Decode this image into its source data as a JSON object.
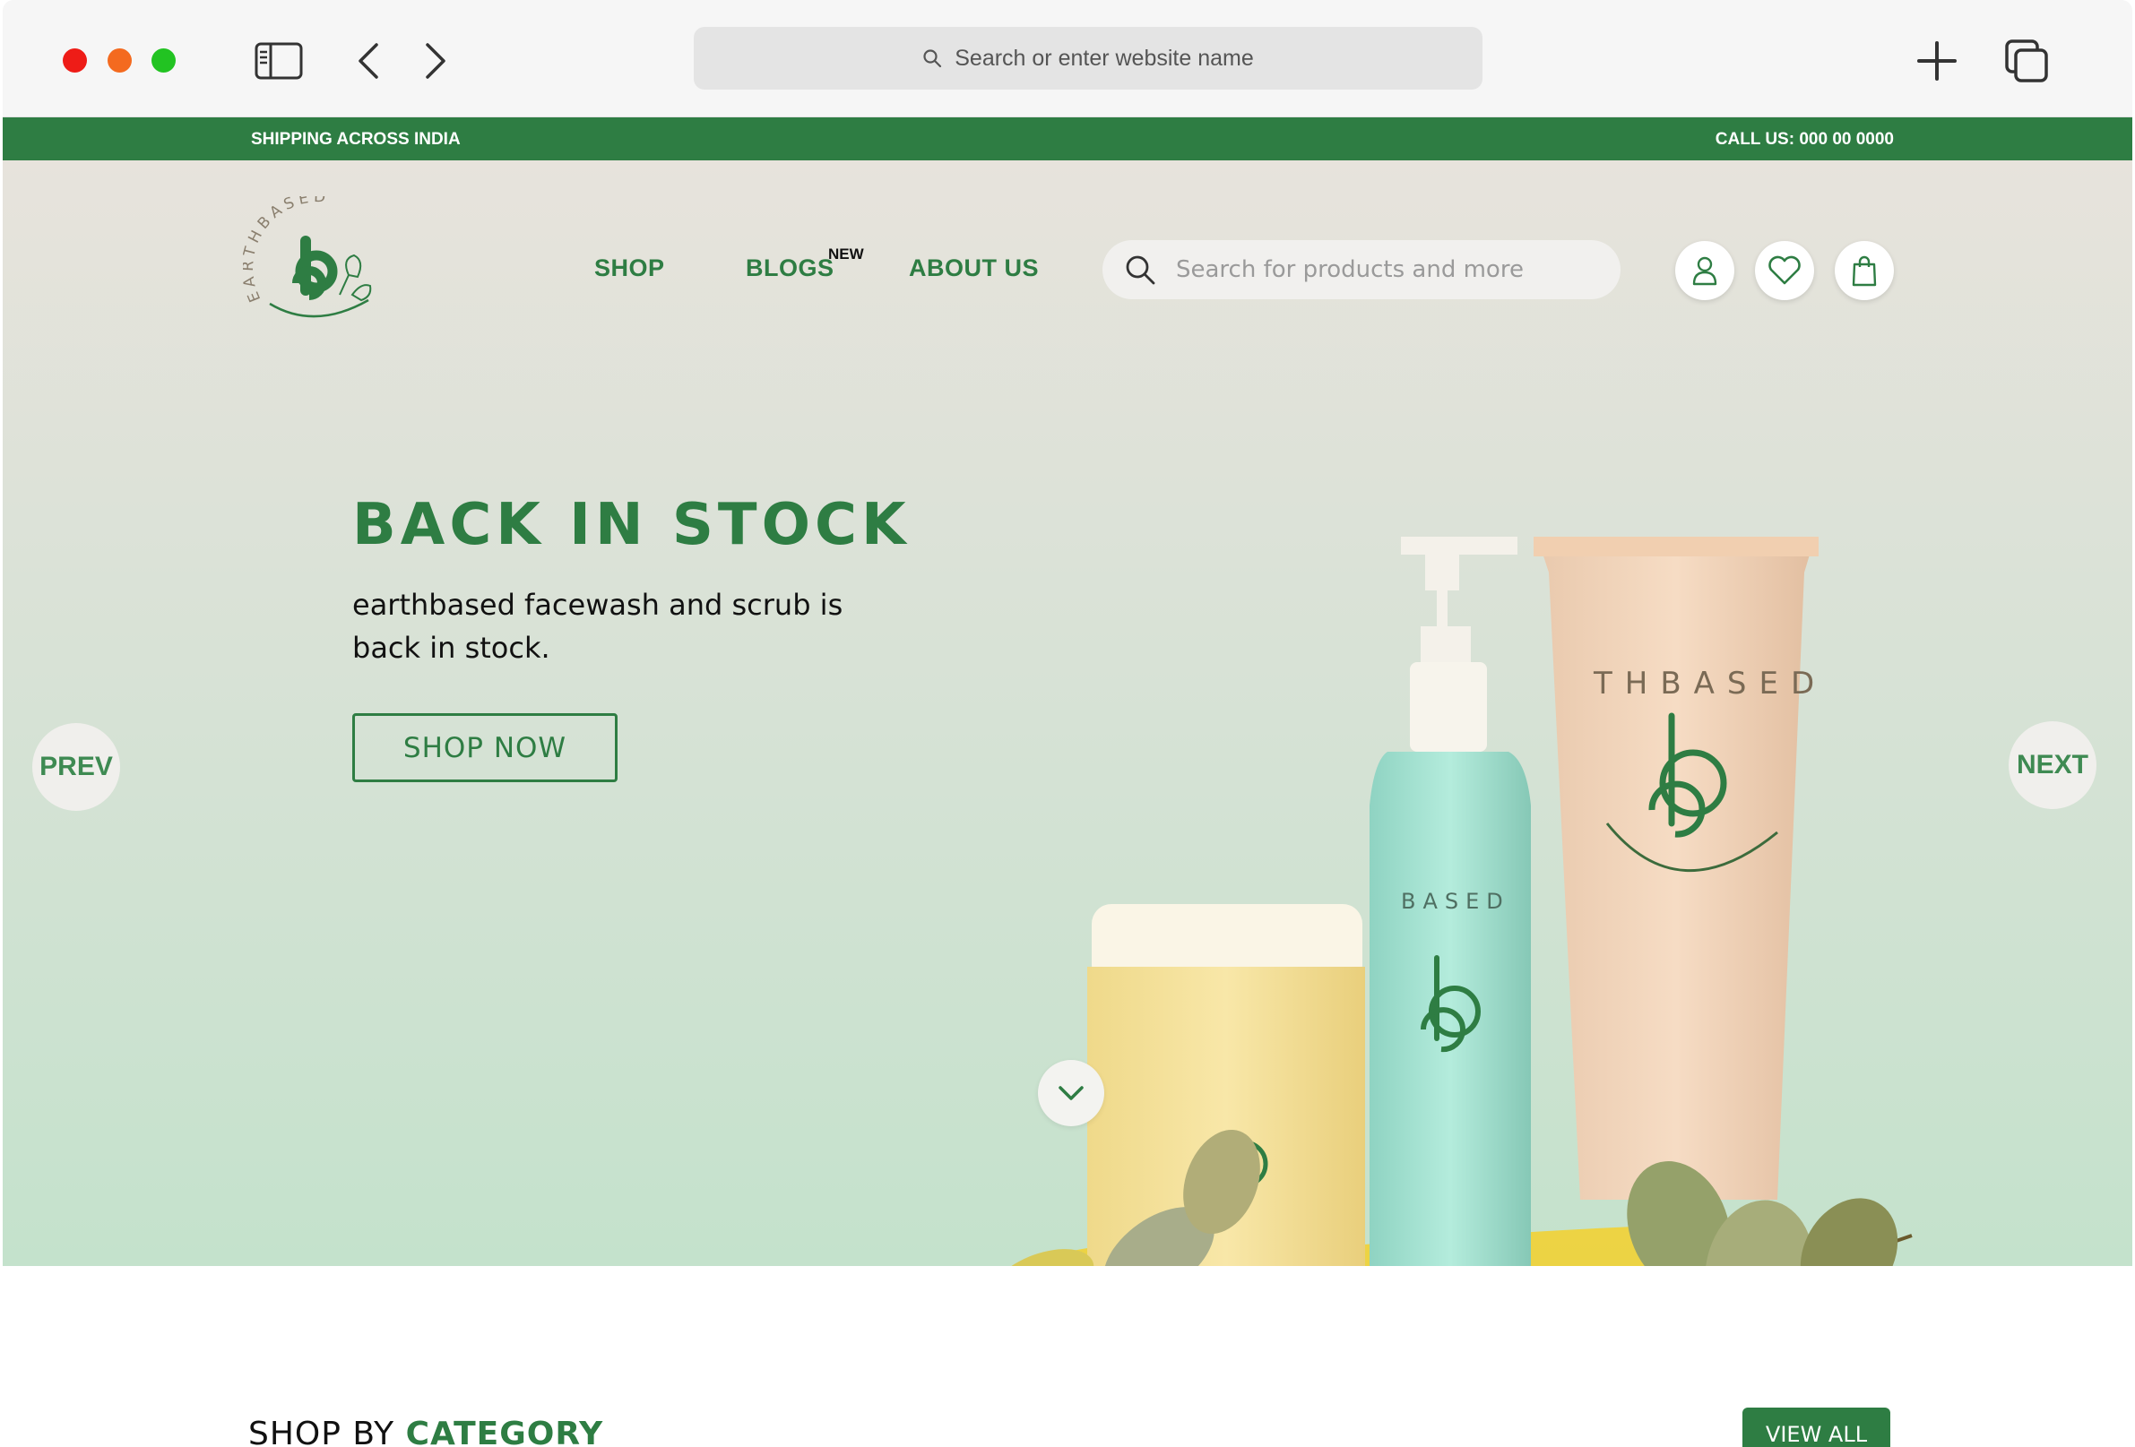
{
  "browser": {
    "url_placeholder": "Search or enter website name"
  },
  "promo": {
    "left": "SHIPPING ACROSS INDIA",
    "right": "CALL US: 000 00 0000"
  },
  "brand": {
    "logo_arc_text": "EARTHBASED",
    "logo_letter": "eb",
    "color": "#2e7d43"
  },
  "nav": {
    "shop": "SHOP",
    "blogs": "BLOGS",
    "blogs_badge": "NEW",
    "about": "ABOUT US"
  },
  "site_search": {
    "placeholder": "Search for products and more"
  },
  "header_icons": [
    "user-icon",
    "heart-icon",
    "shopping-bag-icon"
  ],
  "hero": {
    "title": "BACK IN STOCK",
    "subtitle": "earthbased facewash and scrub is back in stock.",
    "cta": "SHOP NOW",
    "prev": "PREV",
    "next": "NEXT"
  },
  "categories": {
    "title_plain": "SHOP BY",
    "title_accent": "CATEGORY",
    "view_all": "VIEW ALL"
  }
}
